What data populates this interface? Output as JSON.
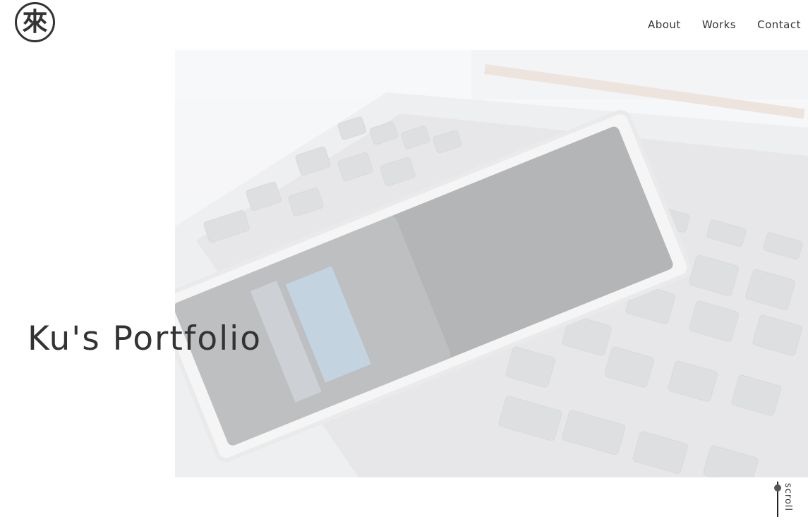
{
  "logo": {
    "glyph": "來"
  },
  "nav": {
    "items": [
      "About",
      "Works",
      "Contact"
    ]
  },
  "hero": {
    "title": "Ku's Portfolio"
  },
  "scroll": {
    "label": "scroll"
  },
  "colors": {
    "text": "#333333",
    "background": "#ffffff"
  }
}
